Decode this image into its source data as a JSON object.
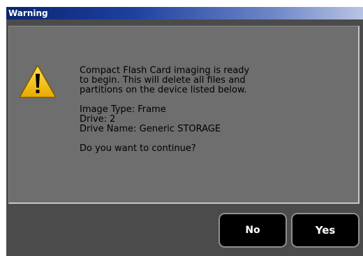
{
  "dialog": {
    "title": "Warning",
    "icon": "warning-triangle-icon",
    "message": {
      "intro_lines": [
        "Compact Flash Card imaging is ready",
        "to begin. This will delete all files and",
        "partitions on the device listed below."
      ],
      "image_type": "Image Type: Frame",
      "drive": "Drive: 2",
      "drive_name": "Drive Name: Generic STORAGE",
      "question": "Do you want to continue?"
    },
    "buttons": {
      "no_label": "No",
      "yes_label": "Yes"
    }
  },
  "colors": {
    "titlebar_start": "#0a2470",
    "titlebar_end": "#b8c4e4",
    "window_bg": "#4b4b4b",
    "panel_bg": "#6e6e6e",
    "button_bg": "#000000",
    "warning_yellow": "#f2c200"
  }
}
